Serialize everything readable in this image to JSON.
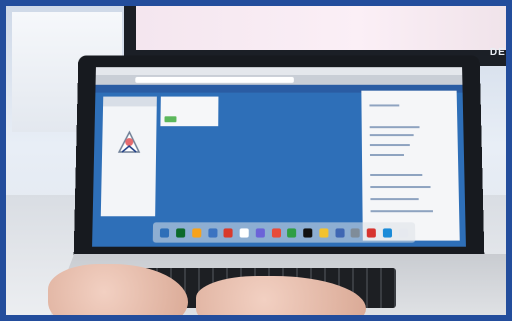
{
  "scene": {
    "background_brand": "DELL",
    "border_color": "#234d9c",
    "screen_color": "#2e6fb8",
    "accent_green": "#5cb85c"
  },
  "laptop": {
    "dock_colors": [
      "#2e6fb8",
      "#0c6a2b",
      "#f7a21b",
      "#3b73c1",
      "#d93a2b",
      "#fff",
      "#6b63d8",
      "#e84b3a",
      "#2f9e44",
      "#111",
      "#f2c230",
      "#3f67b3",
      "#7f8c99",
      "#d7342f",
      "#1b8bd8",
      "#e6e9ef"
    ]
  }
}
